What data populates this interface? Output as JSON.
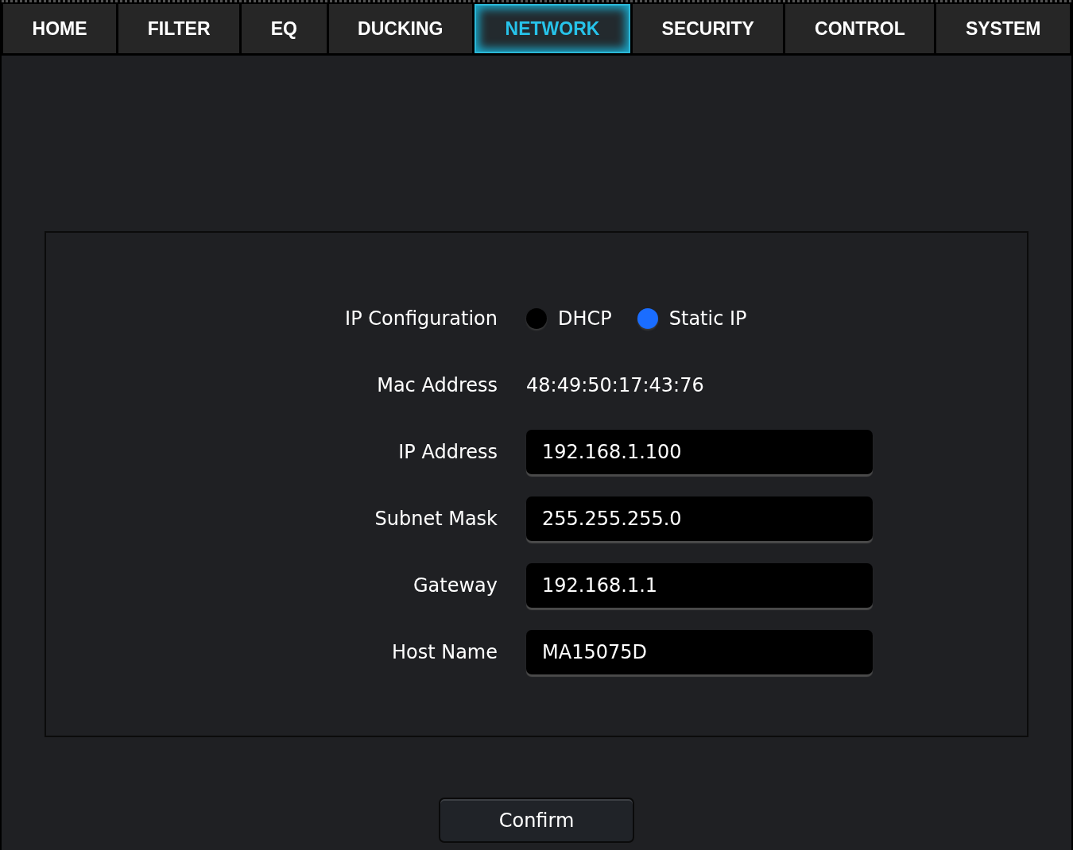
{
  "tabs": [
    {
      "label": "HOME",
      "selected": false
    },
    {
      "label": "FILTER",
      "selected": false
    },
    {
      "label": "EQ",
      "selected": false
    },
    {
      "label": "DUCKING",
      "selected": false
    },
    {
      "label": "NETWORK",
      "selected": true
    },
    {
      "label": "SECURITY",
      "selected": false
    },
    {
      "label": "CONTROL",
      "selected": false
    },
    {
      "label": "SYSTEM",
      "selected": false
    }
  ],
  "ip_configuration": {
    "label": "IP Configuration",
    "options": [
      {
        "label": "DHCP",
        "selected": false
      },
      {
        "label": "Static IP",
        "selected": true
      }
    ]
  },
  "mac_address": {
    "label": "Mac Address",
    "value": "48:49:50:17:43:76"
  },
  "fields": [
    {
      "label": "IP Address",
      "value": "192.168.1.100"
    },
    {
      "label": "Subnet Mask",
      "value": "255.255.255.0"
    },
    {
      "label": "Gateway",
      "value": "192.168.1.1"
    },
    {
      "label": "Host Name",
      "value": "MA15075D"
    }
  ],
  "confirm_button": "Confirm"
}
